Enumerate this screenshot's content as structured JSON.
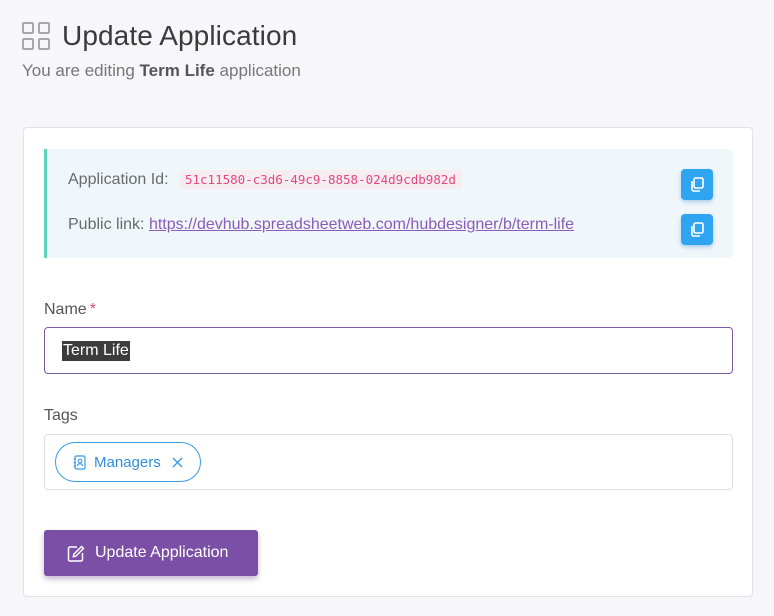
{
  "header": {
    "title": "Update Application",
    "subtitle_prefix": "You are editing",
    "app_name": "Term Life",
    "subtitle_suffix": "application"
  },
  "info": {
    "app_id_label": "Application Id:",
    "app_id_value": "51c11580-c3d6-49c9-8858-024d9cdb982d",
    "public_link_label": "Public link:",
    "public_link_url": "https://devhub.spreadsheetweb.com/hubdesigner/b/term-life"
  },
  "form": {
    "name_label": "Name",
    "required_mark": "*",
    "name_value": "Term Life",
    "tags_label": "Tags",
    "tags": [
      {
        "label": "Managers"
      }
    ],
    "submit_label": "Update Application"
  },
  "icons": {
    "header": "grid-icon",
    "copy": "copy-icon",
    "tag": "contact-book-icon",
    "remove": "close-icon",
    "submit": "edit-icon"
  },
  "colors": {
    "accent": "#7b4fa6",
    "copy_button": "#2fa4f0",
    "info_border": "#5fd3bc",
    "code_text": "#e4487f"
  }
}
